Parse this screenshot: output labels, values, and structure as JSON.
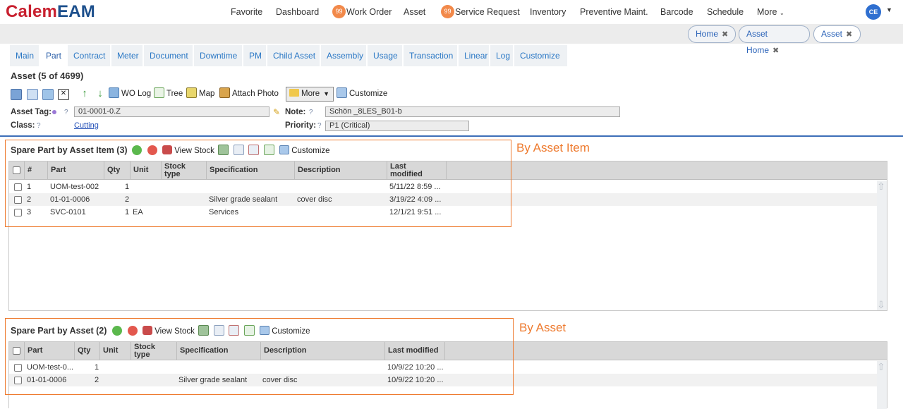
{
  "app": {
    "logo_part1": "Calem",
    "logo_part2": "EAM",
    "user_initials": "CE"
  },
  "nav": {
    "favorite": "Favorite",
    "dashboard": "Dashboard",
    "work_order": "Work Order",
    "work_order_badge": "99",
    "asset": "Asset",
    "service_request": "Service Request",
    "service_request_badge": "99",
    "inventory": "Inventory",
    "preventive": "Preventive Maint.",
    "barcode": "Barcode",
    "schedule": "Schedule",
    "more": "More"
  },
  "breadcrumbs": [
    {
      "label": "Home"
    },
    {
      "label": "Asset Home"
    },
    {
      "label": "Asset"
    }
  ],
  "tabs": [
    "Main",
    "Part",
    "Contract",
    "Meter",
    "Document",
    "Downtime",
    "PM",
    "Child Asset",
    "Assembly",
    "Usage",
    "Transaction",
    "Linear",
    "Log",
    "Customize"
  ],
  "active_tab": "Part",
  "record": {
    "title": "Asset (5 of 4699)"
  },
  "toolbar": {
    "wo_log": "WO Log",
    "tree": "Tree",
    "map": "Map",
    "attach_photo": "Attach Photo",
    "more": "More",
    "customize": "Customize"
  },
  "form": {
    "asset_tag_label": "Asset Tag:",
    "asset_tag_value": "01-0001-0.Z",
    "class_label": "Class:",
    "class_value": "Cutting",
    "note_label": "Note:",
    "note_value": "Schön _8LES_B01-b",
    "priority_label": "Priority:",
    "priority_value": "P1 (Critical)",
    "help": "?"
  },
  "grid1": {
    "title": "Spare Part by Asset Item (3)",
    "view_stock": "View Stock",
    "customize": "Customize",
    "columns": [
      "#",
      "Part",
      "Qty",
      "Unit",
      "Stock type",
      "Specification",
      "Description",
      "Last modified"
    ],
    "col_stock_1": "Stock",
    "col_stock_2": "type",
    "col_last_1": "Last",
    "col_last_2": "modified",
    "rows": [
      {
        "num": "1",
        "part": "UOM-test-002",
        "qty": "1",
        "unit": "",
        "stock_type": "",
        "specification": "",
        "description": "",
        "last_modified": "5/11/22 8:59 ..."
      },
      {
        "num": "2",
        "part": "01-01-0006",
        "qty": "2",
        "unit": "",
        "stock_type": "",
        "specification": "Silver grade sealant",
        "description": "cover disc",
        "last_modified": "3/19/22 4:09 ..."
      },
      {
        "num": "3",
        "part": "SVC-0101",
        "qty": "1",
        "unit": "EA",
        "stock_type": "",
        "specification": "Services",
        "description": "",
        "last_modified": "12/1/21 9:51 ..."
      }
    ],
    "annotation": "By Asset Item"
  },
  "grid2": {
    "title": "Spare Part by Asset (2)",
    "view_stock": "View Stock",
    "customize": "Customize",
    "columns": [
      "Part",
      "Qty",
      "Unit",
      "Stock type",
      "Specification",
      "Description",
      "Last modified"
    ],
    "col_stock_1": "Stock",
    "col_stock_2": "type",
    "rows": [
      {
        "part": "UOM-test-0...",
        "qty": "1",
        "unit": "",
        "stock_type": "",
        "specification": "",
        "description": "",
        "last_modified": "10/9/22 10:20 ..."
      },
      {
        "part": "01-01-0006",
        "qty": "2",
        "unit": "",
        "stock_type": "",
        "specification": "Silver grade sealant",
        "description": "cover disc",
        "last_modified": "10/9/22 10:20 ..."
      }
    ],
    "annotation": "By Asset"
  },
  "colors": {
    "brand_red": "#c8202f",
    "brand_blue": "#1c4f8c",
    "link": "#2b78c5",
    "badge": "#f2894a",
    "annotation": "#ee7a2e"
  }
}
